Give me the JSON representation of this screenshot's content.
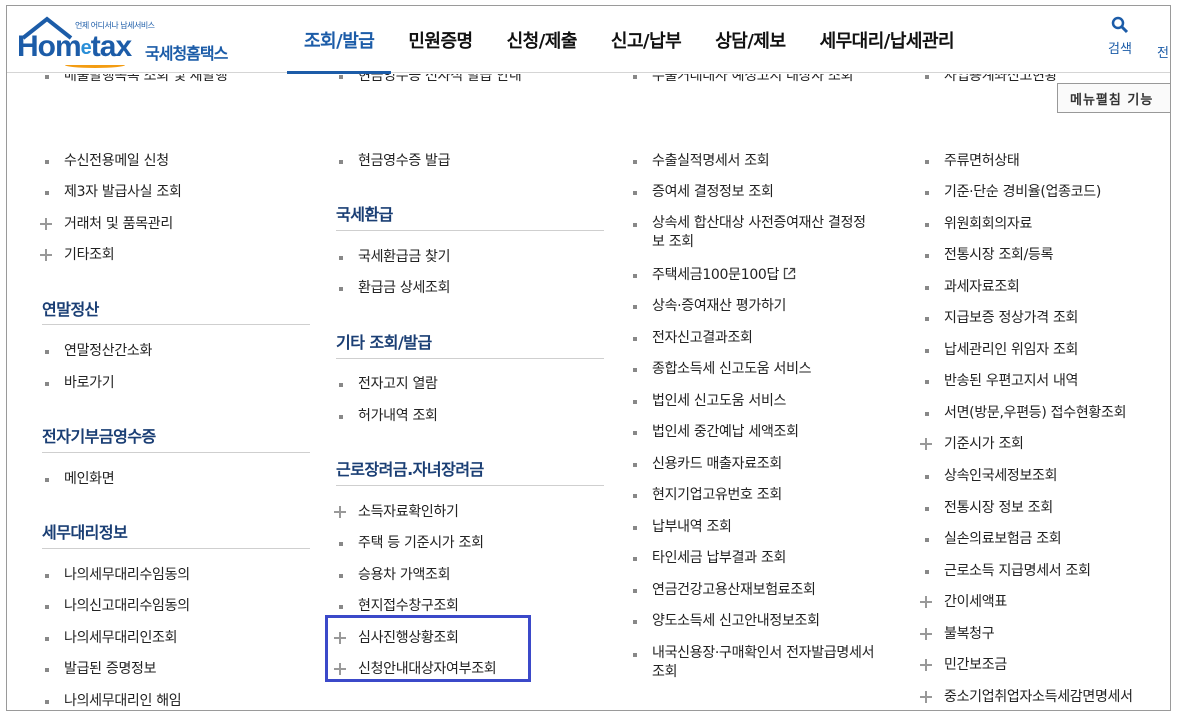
{
  "header": {
    "logo_small": "언제 어디서나 납세서비스",
    "logo_brand_a": "Hom",
    "logo_brand_e": "e",
    "logo_brand_b": "tax",
    "logo_korean": "국세청홈택스",
    "tabs": [
      {
        "label": "조회/발급",
        "active": true
      },
      {
        "label": "민원증명",
        "active": false
      },
      {
        "label": "신청/제출",
        "active": false
      },
      {
        "label": "신고/납부",
        "active": false
      },
      {
        "label": "상담/제보",
        "active": false
      },
      {
        "label": "세무대리/납세관리",
        "active": false
      }
    ],
    "search_label": "검색",
    "cut_label": "전",
    "menu_edit_label": "메뉴펼침 기능"
  },
  "columns": {
    "col1": {
      "items_top": [
        {
          "text": "수신전용메일 신청",
          "type": "bullet"
        },
        {
          "text": "제3자 발급사실 조회",
          "type": "bullet"
        },
        {
          "text": "거래처 및 품목관리",
          "type": "plus"
        },
        {
          "text": "기타조회",
          "type": "plus"
        }
      ],
      "partial_top": "매출발행목록 조회 및 재발행",
      "sections": [
        {
          "title": "연말정산",
          "items": [
            {
              "text": "연말정산간소화",
              "type": "bullet"
            },
            {
              "text": "바로가기",
              "type": "bullet"
            }
          ]
        },
        {
          "title": "전자기부금영수증",
          "items": [
            {
              "text": "메인화면",
              "type": "bullet"
            }
          ]
        },
        {
          "title": "세무대리정보",
          "items": [
            {
              "text": "나의세무대리수임동의",
              "type": "bullet"
            },
            {
              "text": "나의신고대리수임동의",
              "type": "bullet"
            },
            {
              "text": "나의세무대리인조회",
              "type": "bullet"
            },
            {
              "text": "발급된 증명정보",
              "type": "bullet"
            },
            {
              "text": "나의세무대리인 해임",
              "type": "bullet"
            }
          ]
        }
      ]
    },
    "col2": {
      "partial_top": "현금영수증 전자적 발급 안내",
      "items_top": [
        {
          "text": "현금영수증 발급",
          "type": "bullet"
        }
      ],
      "sections": [
        {
          "title": "국세환급",
          "items": [
            {
              "text": "국세환급금 찾기",
              "type": "bullet"
            },
            {
              "text": "환급금 상세조회",
              "type": "bullet"
            }
          ]
        },
        {
          "title": "기타 조회/발급",
          "items": [
            {
              "text": "전자고지 열람",
              "type": "bullet"
            },
            {
              "text": "허가내역 조회",
              "type": "bullet"
            }
          ]
        },
        {
          "title": "근로장려금.자녀장려금",
          "items": [
            {
              "text": "소득자료확인하기",
              "type": "plus"
            },
            {
              "text": "주택 등 기준시가 조회",
              "type": "bullet"
            },
            {
              "text": "승용차 가액조회",
              "type": "bullet"
            },
            {
              "text": "현지접수창구조회",
              "type": "bullet"
            },
            {
              "text": "심사진행상황조회",
              "type": "plus"
            },
            {
              "text": "신청안내대상자여부조회",
              "type": "plus"
            }
          ]
        }
      ]
    },
    "col3": {
      "partial_top": "수출거래대사 예정고지 대상자 조회",
      "items": [
        {
          "text": "수출실적명세서 조회",
          "type": "bullet"
        },
        {
          "text": "증여세 결정정보 조회",
          "type": "bullet"
        },
        {
          "text": "상속세 합산대상 사전증여재산 결정정보 조회",
          "type": "bullet",
          "wrap": true
        },
        {
          "text": "주택세금100문100답",
          "type": "bullet",
          "external": true
        },
        {
          "text": "상속·증여재산 평가하기",
          "type": "bullet"
        },
        {
          "text": "전자신고결과조회",
          "type": "bullet"
        },
        {
          "text": "종합소득세 신고도움 서비스",
          "type": "bullet"
        },
        {
          "text": "법인세 신고도움 서비스",
          "type": "bullet"
        },
        {
          "text": "법인세 중간예납 세액조회",
          "type": "bullet"
        },
        {
          "text": "신용카드 매출자료조회",
          "type": "bullet"
        },
        {
          "text": "현지기업고유번호 조회",
          "type": "bullet"
        },
        {
          "text": "납부내역 조회",
          "type": "bullet"
        },
        {
          "text": "타인세금 납부결과 조회",
          "type": "bullet"
        },
        {
          "text": "연금건강고용산재보험료조회",
          "type": "bullet"
        },
        {
          "text": "양도소득세 신고안내정보조회",
          "type": "bullet"
        },
        {
          "text": "내국신용장·구매확인서 전자발급명세서 조회",
          "type": "bullet",
          "wrap": true
        }
      ]
    },
    "col4": {
      "partial_top": "사업용계좌신고현황",
      "items": [
        {
          "text": "주류면허상태",
          "type": "bullet"
        },
        {
          "text": "기준·단순 경비율(업종코드)",
          "type": "bullet"
        },
        {
          "text": "위원회회의자료",
          "type": "bullet"
        },
        {
          "text": "전통시장 조회/등록",
          "type": "bullet"
        },
        {
          "text": "과세자료조회",
          "type": "bullet"
        },
        {
          "text": "지급보증 정상가격 조회",
          "type": "bullet"
        },
        {
          "text": "납세관리인 위임자 조회",
          "type": "bullet"
        },
        {
          "text": "반송된 우편고지서 내역",
          "type": "bullet"
        },
        {
          "text": "서면(방문,우편등) 접수현황조회",
          "type": "bullet"
        },
        {
          "text": "기준시가 조회",
          "type": "plus"
        },
        {
          "text": "상속인국세정보조회",
          "type": "bullet"
        },
        {
          "text": "전통시장 정보 조회",
          "type": "bullet"
        },
        {
          "text": "실손의료보험금 조회",
          "type": "bullet"
        },
        {
          "text": "근로소득 지급명세서 조회",
          "type": "bullet"
        },
        {
          "text": "간이세액표",
          "type": "plus"
        },
        {
          "text": "불복청구",
          "type": "plus"
        },
        {
          "text": "민간보조금",
          "type": "plus"
        },
        {
          "text": "중소기업취업자소득세감면명세서",
          "type": "plus"
        }
      ]
    }
  },
  "colors": {
    "brand": "#1c5ca8",
    "section_title": "#1a3e74",
    "highlight_border": "#3b49c9"
  }
}
